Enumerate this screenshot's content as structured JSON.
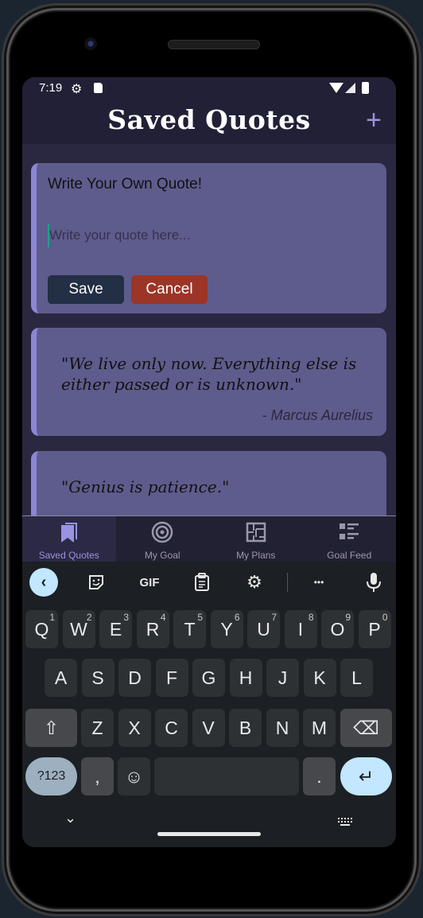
{
  "status_bar": {
    "time": "7:19",
    "icons": [
      "settings-gear-icon",
      "sd-card-icon",
      "wifi-icon",
      "cell-signal-icon",
      "battery-icon"
    ]
  },
  "app_bar": {
    "title": "Saved Quotes",
    "add_icon": "+"
  },
  "editor_card": {
    "heading": "Write Your Own Quote!",
    "input_value": "",
    "input_placeholder": "Write your quote here...",
    "save_label": "Save",
    "cancel_label": "Cancel"
  },
  "quotes": [
    {
      "text": "\"We live only now. Everything else is either passed or is unknown.\"",
      "author": "- Marcus Aurelius"
    },
    {
      "text": "\"Genius is patience.\"",
      "author": ""
    }
  ],
  "bottom_nav": {
    "items": [
      {
        "label": "Saved Quotes",
        "icon": "bookmarks-icon",
        "active": true
      },
      {
        "label": "My Goal",
        "icon": "target-icon",
        "active": false
      },
      {
        "label": "My Plans",
        "icon": "floor-plan-icon",
        "active": false
      },
      {
        "label": "Goal Feed",
        "icon": "feed-list-icon",
        "active": false
      }
    ]
  },
  "keyboard": {
    "toolbar": {
      "back": "‹",
      "gif": "GIF",
      "more": "•••"
    },
    "row1": [
      {
        "k": "Q",
        "h": "1"
      },
      {
        "k": "W",
        "h": "2"
      },
      {
        "k": "E",
        "h": "3"
      },
      {
        "k": "R",
        "h": "4"
      },
      {
        "k": "T",
        "h": "5"
      },
      {
        "k": "Y",
        "h": "6"
      },
      {
        "k": "U",
        "h": "7"
      },
      {
        "k": "I",
        "h": "8"
      },
      {
        "k": "O",
        "h": "9"
      },
      {
        "k": "P",
        "h": "0"
      }
    ],
    "row2": [
      "A",
      "S",
      "D",
      "F",
      "G",
      "H",
      "J",
      "K",
      "L"
    ],
    "row3": [
      "Z",
      "X",
      "C",
      "V",
      "B",
      "N",
      "M"
    ],
    "symbols_label": "?123",
    "comma": ",",
    "period": ".",
    "shift": "⇧",
    "backspace": "⌫",
    "enter": "↵",
    "emoji": "☺",
    "collapse": "⌄"
  }
}
